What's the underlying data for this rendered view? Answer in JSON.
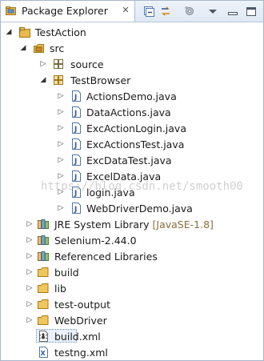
{
  "view": {
    "title": "Package Explorer",
    "close_glyph": "✕"
  },
  "toolbar": {
    "buttons": [
      {
        "name": "collapse-all-icon"
      },
      {
        "name": "link-with-editor-icon"
      },
      {
        "name": "view-settings-icon"
      },
      {
        "name": "view-menu-icon"
      },
      {
        "name": "minimize-icon"
      },
      {
        "name": "maximize-icon"
      }
    ]
  },
  "tree": {
    "project": "TestAction",
    "src": "src",
    "source_pkg": "source",
    "testbrowser_pkg": "TestBrowser",
    "files": [
      "ActionsDemo.java",
      "DataActions.java",
      "ExcActionLogin.java",
      "ExcActionsTest.java",
      "ExcDataTest.java",
      "ExcelData.java",
      "login.java",
      "WebDriverDemo.java"
    ],
    "jre": "JRE System Library",
    "jre_version": "[JavaSE-1.8]",
    "selenium": "Selenium-2.44.0",
    "referenced": "Referenced Libraries",
    "folders": [
      "build",
      "lib",
      "test-output",
      "WebDriver"
    ],
    "build_xml": "build.xml",
    "testng_xml": "testng.xml"
  },
  "watermark": "https://blog.csdn.net/smooth00"
}
